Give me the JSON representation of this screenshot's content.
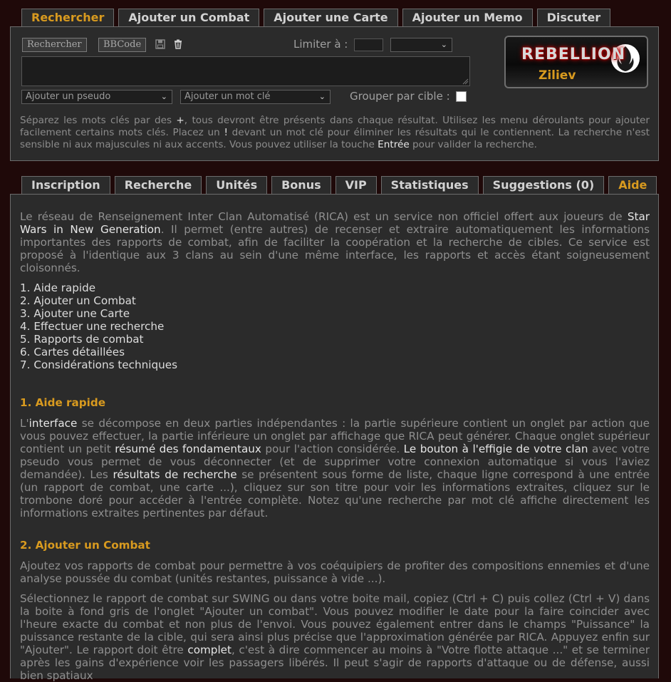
{
  "top_tabs": [
    "Rechercher",
    "Ajouter un Combat",
    "Ajouter une Carte",
    "Ajouter un Memo",
    "Discuter"
  ],
  "search": {
    "rechercher_button": "Rechercher",
    "bbcode_button": "BBCode",
    "limit_label": "Limiter à :",
    "pseudo_select": "Ajouter un pseudo",
    "keyword_select": "Ajouter un mot clé",
    "group_label": "Grouper par cible :",
    "help": {
      "t1": "Séparez les mots clés par des ",
      "plus": "+",
      "t2": ", tous devront être présents dans chaque résultat. Utilisez les menu déroulants pour ajouter facilement certains mots clés. Placez un ",
      "bang": "!",
      "t3": " devant un mot clé pour éliminer les résultats qui le contiennent. La recherche n'est sensible ni aux majuscules ni aux accents. Vous pouvez utiliser la touche ",
      "enter": "Entrée",
      "t4": " pour valider la recherche."
    }
  },
  "logo": {
    "word": "REBELLION",
    "user": "Ziliev"
  },
  "bottom_tabs": [
    "Inscription",
    "Recherche",
    "Unités",
    "Bonus",
    "VIP",
    "Statistiques",
    "Suggestions (0)",
    "Aide"
  ],
  "aide": {
    "intro": {
      "t1": "Le réseau de Renseignement Inter Clan Automatisé (RICA) est un service non officiel offert aux joueurs de ",
      "link": "Star Wars in New Generation",
      "t2": ". Il permet (entre autres) de recenser et extraire automatiquement les informations importantes des rapports de combat, afin de faciliter la coopération et la recherche de cibles. Ce service est proposé à l'identique aux 3 clans au sein d'une même interface, les rapports et accès étant soigneusement cloisonnés."
    },
    "toc": [
      "1. Aide rapide",
      "2. Ajouter un Combat",
      "3. Ajouter une Carte",
      "4. Effectuer une recherche",
      "5. Rapports de combat",
      "6. Cartes détaillées",
      "7. Considérations techniques"
    ],
    "s1_title": "1. Aide rapide",
    "s1": {
      "a": "L'",
      "b": "interface",
      "c": " se décompose en deux parties indépendantes : la partie supérieure contient un onglet par action que vous pouvez effectuer, la partie inférieure un onglet par affichage que RICA peut générer. Chaque onglet supérieur contient un petit ",
      "d": "résumé des fondamentaux",
      "e": " pour l'action considérée. ",
      "f": "Le bouton à l'effigie de votre clan",
      "g": " avec votre pseudo vous permet de vous déconnecter (et de supprimer votre connexion automatique si vous l'aviez demandée). Les ",
      "h": "résultats de recherche",
      "i": " se présentent sous forme de liste, chaque ligne correspond à une entrée (un rapport de combat, une carte ...), cliquez sur son titre pour voir les informations extraites, cliquez sur le trombone doré pour accéder à l'entrée complète. Notez qu'une recherche par mot clé affiche directement les informations extraites pertinentes par défaut."
    },
    "s2_title": "2. Ajouter un Combat",
    "s2_p1": "Ajoutez vos rapports de combat pour permettre à vos coéquipiers de profiter des compositions ennemies et d'une analyse poussée du combat (unités restantes, puissance à vide ...).",
    "s2_p2": {
      "a": "Sélectionnez le rapport de combat sur SWING ou dans votre boite mail, copiez (Ctrl + C) puis collez (Ctrl + V) dans la boite à fond gris de l'onglet \"Ajouter un combat\". Vous pouvez modifier le date pour la faire coincider avec l'heure exacte du combat et non plus de l'envoi. Vous pouvez également entrer dans le champs \"Puissance\" la puissance restante de la cible, qui sera ainsi plus précise que l'approximation générée par RICA. Appuyez enfin sur \"Ajouter\". Le rapport doit être ",
      "b": "complet",
      "c": ", c'est à dire commencer au moins à \"Votre flotte attaque ...\" et se terminer après les gains d'expérience voir les passagers libérés. Il peut s'agir de rapports d'attaque ou de défense, aussi bien spatiaux"
    }
  },
  "colors": {
    "accent": "#d89a1f",
    "background": "#1f0909",
    "panel": "#2b2b2b"
  }
}
